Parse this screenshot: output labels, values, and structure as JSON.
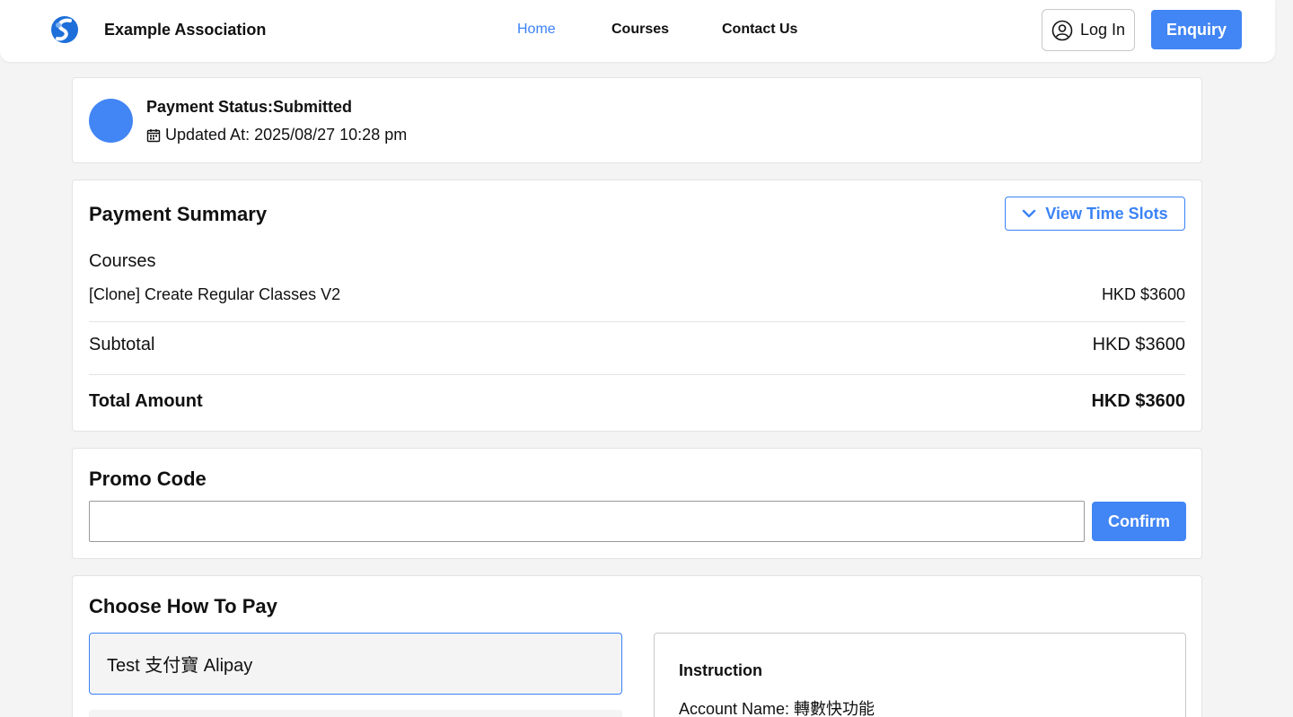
{
  "header": {
    "brand": "Example Association",
    "nav": [
      "Home",
      "Courses",
      "Contact Us"
    ],
    "login_label": "Log In",
    "enquiry_label": "Enquiry"
  },
  "status": {
    "title": "Payment Status:Submitted",
    "updated": "Updated At: 2025/08/27 10:28 pm"
  },
  "summary": {
    "title": "Payment Summary",
    "view_time_slots": "View Time Slots",
    "courses_label": "Courses",
    "course_name": "[Clone] Create Regular Classes V2",
    "course_price": "HKD $3600",
    "subtotal_label": "Subtotal",
    "subtotal_value": "HKD $3600",
    "total_label": "Total Amount",
    "total_value": "HKD $3600"
  },
  "promo": {
    "title": "Promo Code",
    "input_value": "",
    "confirm_label": "Confirm"
  },
  "payment": {
    "title": "Choose How To Pay",
    "selected_option": "Test 支付寶 Alipay",
    "instruction_title": "Instruction",
    "instruction_account": "Account Name: 轉數快功能"
  },
  "colors": {
    "accent": "#4285f4",
    "link": "#3b82f6",
    "background": "#f4f4f5"
  }
}
